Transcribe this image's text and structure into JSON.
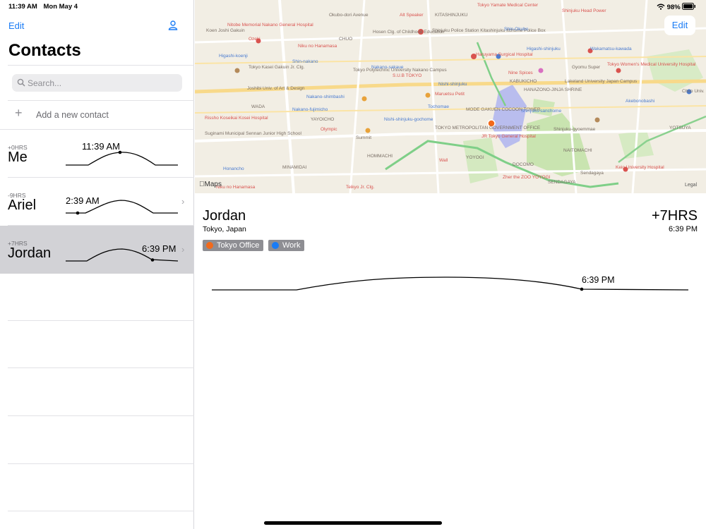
{
  "status": {
    "time": "11:39 AM",
    "date": "Mon May 4",
    "battery": "98%"
  },
  "sidebar": {
    "edit_label": "Edit",
    "title": "Contacts",
    "search_placeholder": "Search...",
    "add_label": "Add a new contact",
    "contacts": [
      {
        "offset": "+0HRS",
        "name": "Me",
        "time": "11:39 AM",
        "selected": false
      },
      {
        "offset": "-9HRS",
        "name": "Ariel",
        "time": "2:39 AM",
        "selected": false
      },
      {
        "offset": "+7HRS",
        "name": "Jordan",
        "time": "6:39 PM",
        "selected": true
      }
    ]
  },
  "map": {
    "edit_label": "Edit",
    "attribution": "Maps",
    "legal": "Legal",
    "labels": [
      "Laboratory Sciences",
      "Alt Speaker",
      "KITASHINJUKU",
      "Tokyo Yamate Medical Center",
      "Shinjuku Head Power",
      "National Center for Global Health & Medicine",
      "Okubo-dori Avenue",
      "Koen Joshi Gakuin",
      "Nitobe Memorial Nakano General Hospital",
      "Hosen Clg. of Childhood Education",
      "Shinjuku Police Station Kitashinjuku Itchome Police Box",
      "Okubo",
      "Shin-Okubo",
      "Wakamatsu-kawada",
      "Ushigome-yanagicho",
      "Ozeki",
      "CHUO",
      "Niku no Hanamasa",
      "Higashi-koenji",
      "Shin-nakano",
      "Haruyama Surgical Hospital",
      "Higashi-shinjuku",
      "Gyomu Super",
      "Tokyo Women's Medical University Hospital",
      "Tokyo Kasei Gakuin Jr. Clg.",
      "Nakano-sakaue",
      "Tokyo Polytechnic University Nakano Campus",
      "Nishi-shinjuku",
      "S.U.B TOKYO",
      "Nine Spices",
      "KABUKICHO",
      "Lakeland University Japan Campus",
      "Joshibi Univ. of Art & Design",
      "Nakano-shimbashi",
      "3GOKAN",
      "Maruetsu Petit",
      "HANAZONO-JINJA SHRINE",
      "Chuo Univ.",
      "WADA",
      "Nakano-fujimicho",
      "Tochomae",
      "MODE GAKUEN COCOON TOWER",
      "Shinjuku-sanchome",
      "Akebonobashi",
      "Rissho Koseikai Kosei Hospital",
      "YAYOICHO",
      "Nishi-shinjuku-gochome",
      "YOTSUYA",
      "Olympic",
      "TOKYO METROPOLITAN GOVERNMENT OFFICE",
      "JR Tokyo General Hospital",
      "Shinjuku-gyoemmae",
      "Suginami Municipal Sennan Junior High School",
      "Summit",
      "NAITOMACHI",
      "HOMMACHI",
      "YOYOGI",
      "DOCOMO",
      "MINAMIDAI",
      "Wall",
      "Sendagaya",
      "Keio University Hospital",
      "Honancho",
      "Zher the ZOO YOYOGI",
      "SENDAGAYA",
      "Teikyo Jr. Clg.",
      "Niku no Hanamasa",
      "Nishi-Shinjuku",
      "Yotsuya-sanchome",
      "Shinanomachi"
    ]
  },
  "detail": {
    "name": "Jordan",
    "location": "Tokyo, Japan",
    "offset": "+7HRS",
    "time": "6:39 PM",
    "tags": [
      {
        "label": "Tokyo Office",
        "color": "#f26a1b"
      },
      {
        "label": "Work",
        "color": "#1a7cf5"
      }
    ]
  }
}
